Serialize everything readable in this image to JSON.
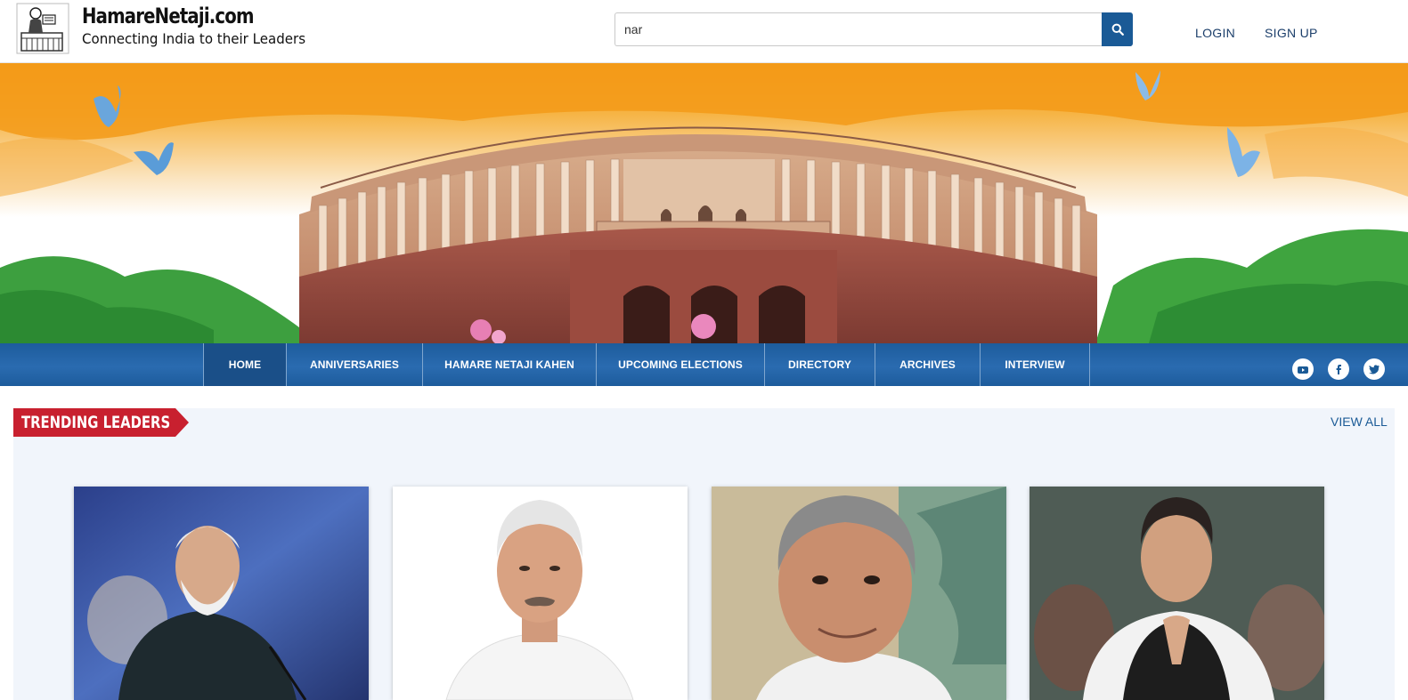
{
  "brand": {
    "name": "HamareNetaji.com",
    "tagline": "Connecting India to their Leaders",
    "logo_icon": "parliament-leader-logo-icon"
  },
  "search": {
    "value": "nar",
    "icon": "search-icon"
  },
  "auth": {
    "login_label": "LOGIN",
    "signup_label": "SIGN UP"
  },
  "nav": {
    "items": [
      {
        "label": "HOME",
        "active": true
      },
      {
        "label": "ANNIVERSARIES",
        "active": false
      },
      {
        "label": "HAMARE NETAJI KAHEN",
        "active": false
      },
      {
        "label": "UPCOMING ELECTIONS",
        "active": false
      },
      {
        "label": "DIRECTORY",
        "active": false
      },
      {
        "label": "ARCHIVES",
        "active": false
      },
      {
        "label": "INTERVIEW",
        "active": false
      }
    ],
    "social": [
      "youtube-icon",
      "facebook-icon",
      "twitter-icon"
    ]
  },
  "trending": {
    "title": "TRENDING LEADERS",
    "view_all_label": "VIEW ALL"
  },
  "colors": {
    "brand_blue": "#1a5a96",
    "nav_blue": "#2a6bb0",
    "ribbon_red": "#c8202f",
    "panel_bg": "#f1f5fb",
    "saffron": "#f4a11c",
    "green": "#3aa43a"
  }
}
